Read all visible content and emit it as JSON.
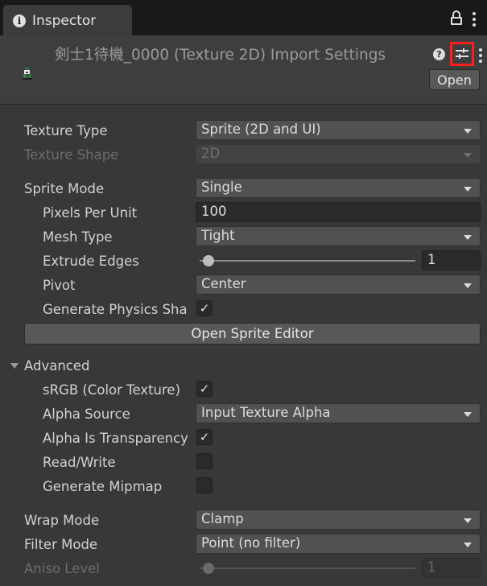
{
  "tab": {
    "label": "Inspector"
  },
  "header": {
    "title": "剣士1待機_0000 (Texture 2D) Import Settings",
    "open_label": "Open"
  },
  "fields": {
    "texture_type": {
      "label": "Texture Type",
      "value": "Sprite (2D and UI)"
    },
    "texture_shape": {
      "label": "Texture Shape",
      "value": "2D"
    },
    "sprite_mode": {
      "label": "Sprite Mode",
      "value": "Single"
    },
    "pixels_per_unit": {
      "label": "Pixels Per Unit",
      "value": "100"
    },
    "mesh_type": {
      "label": "Mesh Type",
      "value": "Tight"
    },
    "extrude_edges": {
      "label": "Extrude Edges",
      "value": "1",
      "slider_fraction": 0.04
    },
    "pivot": {
      "label": "Pivot",
      "value": "Center"
    },
    "generate_physics_shape": {
      "label": "Generate Physics Sha",
      "checked": true
    },
    "open_sprite_editor": {
      "label": "Open Sprite Editor"
    },
    "advanced": {
      "label": "Advanced"
    },
    "srgb": {
      "label": "sRGB (Color Texture)",
      "checked": true
    },
    "alpha_source": {
      "label": "Alpha Source",
      "value": "Input Texture Alpha"
    },
    "alpha_is_transparency": {
      "label": "Alpha Is Transparency",
      "checked": true
    },
    "read_write": {
      "label": "Read/Write",
      "checked": false
    },
    "generate_mipmap": {
      "label": "Generate Mipmap",
      "checked": false
    },
    "wrap_mode": {
      "label": "Wrap Mode",
      "value": "Clamp"
    },
    "filter_mode": {
      "label": "Filter Mode",
      "value": "Point (no filter)"
    },
    "aniso_level": {
      "label": "Aniso Level",
      "value": "1",
      "slider_fraction": 0.0
    }
  },
  "check_glyph": "✓",
  "icons": [
    "info-icon",
    "lock-icon",
    "more-icon",
    "help-icon",
    "preset-icon",
    "sprite-thumbnail",
    "dropdown-arrow-icon",
    "foldout-arrow-icon"
  ],
  "colors": {
    "highlight": "#ff1d1d",
    "panel": "#383838",
    "field": "#515151"
  }
}
